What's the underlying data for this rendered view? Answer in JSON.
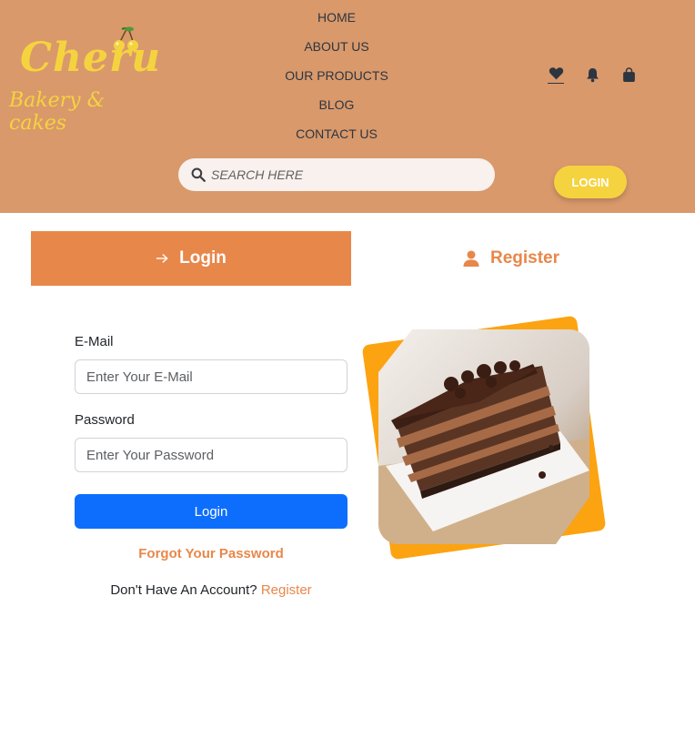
{
  "header": {
    "logo_text": "Cheru",
    "logo_tagline": "Bakery & cakes",
    "nav": [
      "HOME",
      "ABOUT US",
      "OUR PRODUCTS",
      "BLOG",
      "CONTACT US"
    ],
    "icons": [
      "heart-icon",
      "bell-icon",
      "shopping-bag-icon"
    ],
    "search_placeholder": "SEARCH HERE",
    "login_label": "LOGIN"
  },
  "tabs": {
    "login_label": "Login",
    "register_label": "Register"
  },
  "form": {
    "email_label": "E-Mail",
    "email_placeholder": "Enter Your E-Mail",
    "password_label": "Password",
    "password_placeholder": "Enter Your Password",
    "submit_label": "Login",
    "forgot_label": "Forgot Your Password",
    "no_account_text": "Don't Have An Account?",
    "register_link": "Register"
  },
  "colors": {
    "header_bg": "#d9996b",
    "accent_orange": "#e8874a",
    "logo_yellow": "#f5d33f",
    "primary_blue": "#0d6efd",
    "image_frame": "#fca311"
  }
}
